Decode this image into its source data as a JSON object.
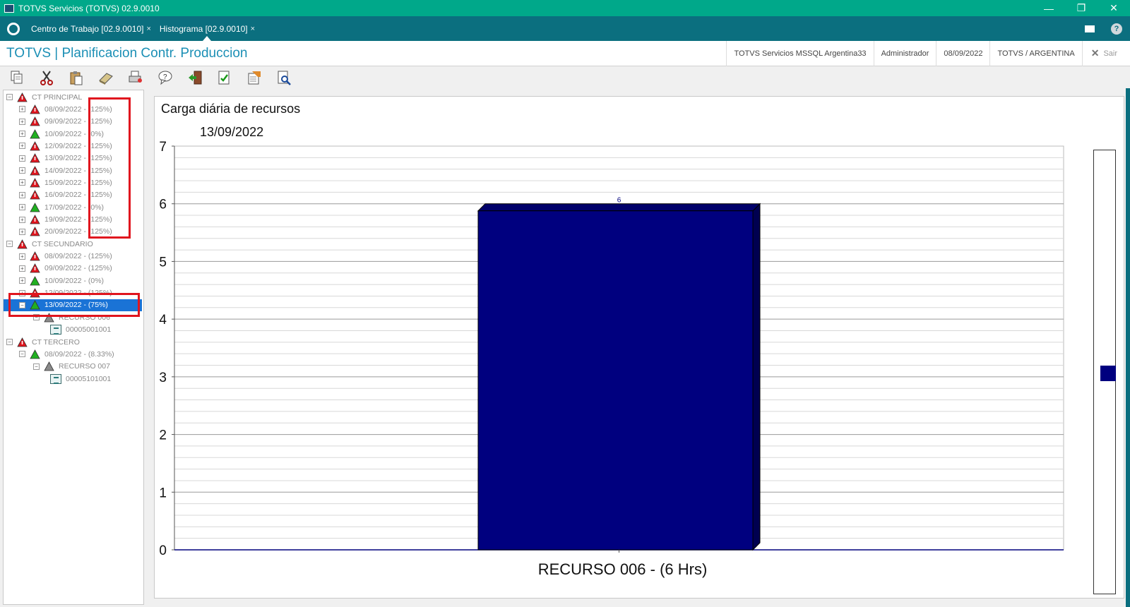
{
  "window": {
    "title": "TOTVS Servicios (TOTVS) 02.9.0010",
    "minimize": "—",
    "restore": "❐",
    "close": "✕"
  },
  "tabs": [
    {
      "label": "Centro de Trabajo [02.9.0010]",
      "close": "×"
    },
    {
      "label": "Histograma [02.9.0010]",
      "close": "×"
    }
  ],
  "tab_icons": {
    "help": "?"
  },
  "header": {
    "app_title": "TOTVS | Planificacion Contr. Produccion",
    "server": "TOTVS Servicios MSSQL Argentina33",
    "user": "Administrador",
    "date": "08/09/2022",
    "company": "TOTVS / ARGENTINA",
    "exit_label": "Sair",
    "exit_icon": "✕"
  },
  "toolbar": [
    "copy-icon",
    "cut-icon",
    "paste-icon",
    "eraser-icon",
    "print-icon",
    "help-icon",
    "exit-door-icon",
    "confirm-document-icon",
    "notes-icon",
    "search-preview-icon"
  ],
  "tree": {
    "groups": [
      {
        "label": "CT PRINCIPAL",
        "items": [
          {
            "label": "08/09/2022 - (125%)",
            "status": "red"
          },
          {
            "label": "09/09/2022 - (125%)",
            "status": "red"
          },
          {
            "label": "10/09/2022 - (0%)",
            "status": "green"
          },
          {
            "label": "12/09/2022 - (125%)",
            "status": "red"
          },
          {
            "label": "13/09/2022 - (125%)",
            "status": "red"
          },
          {
            "label": "14/09/2022 - (125%)",
            "status": "red"
          },
          {
            "label": "15/09/2022 - (125%)",
            "status": "red"
          },
          {
            "label": "16/09/2022 - (125%)",
            "status": "red"
          },
          {
            "label": "17/09/2022 - (0%)",
            "status": "green"
          },
          {
            "label": "19/09/2022 - (125%)",
            "status": "red"
          },
          {
            "label": "20/09/2022 - (125%)",
            "status": "red"
          }
        ]
      },
      {
        "label": "CT SECUNDARIO",
        "items": [
          {
            "label": "08/09/2022 - (125%)",
            "status": "red"
          },
          {
            "label": "09/09/2022 - (125%)",
            "status": "red"
          },
          {
            "label": "10/09/2022 - (0%)",
            "status": "green"
          },
          {
            "label": "12/09/2022 - (125%)",
            "status": "red"
          },
          {
            "label": "13/09/2022 - (75%)",
            "status": "green",
            "selected": true
          },
          {
            "label": "RECURSO 006",
            "status": "grey"
          },
          {
            "label": "00005001001",
            "status": "doc"
          }
        ]
      },
      {
        "label": "CT TERCERO",
        "items": [
          {
            "label": "08/09/2022 - (8.33%)",
            "status": "green"
          },
          {
            "label": "RECURSO 007",
            "status": "grey"
          },
          {
            "label": "00005101001",
            "status": "doc"
          }
        ]
      }
    ]
  },
  "colors": {
    "accent": "#00a88a",
    "tabbar": "#0b6f7f",
    "title": "#1b8fb5",
    "bar": "#00007f",
    "highlight": "#e0151e",
    "selected": "#1a73d6"
  },
  "chart_data": {
    "type": "bar",
    "title": "Carga diária de recursos",
    "subtitle": "13/09/2022",
    "categories": [
      "RECURSO 006 - (6 Hrs)"
    ],
    "values": [
      6
    ],
    "data_labels": [
      "6"
    ],
    "ylim": [
      0,
      7
    ],
    "yticks": [
      "0",
      "1",
      "2",
      "3",
      "4",
      "5",
      "6",
      "7"
    ],
    "grid": true,
    "legend": "right"
  }
}
